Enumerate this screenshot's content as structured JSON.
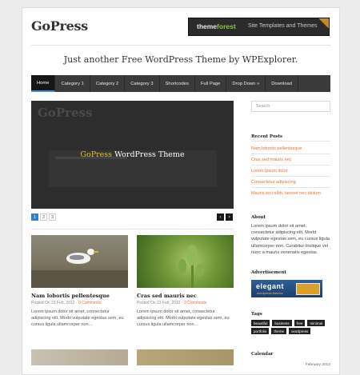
{
  "site": {
    "logo": "GoPress",
    "tagline": "Just another Free WordPress Theme by WPExplorer."
  },
  "banner": {
    "brand_prefix": "theme",
    "brand_suffix": "forest",
    "tagline": "Site Templates and Themes"
  },
  "nav": {
    "items": [
      {
        "label": "Home",
        "active": true
      },
      {
        "label": "Category 1",
        "active": false
      },
      {
        "label": "Category 2",
        "active": false
      },
      {
        "label": "Category 3",
        "active": false
      },
      {
        "label": "Shortcodes",
        "active": false
      },
      {
        "label": "Full Page",
        "active": false
      },
      {
        "label": "Drop Down »",
        "active": false
      },
      {
        "label": "Download",
        "active": false
      }
    ]
  },
  "slider": {
    "caption_brand": "GoPress",
    "caption_rest": " WordPress Theme",
    "pages": [
      "1",
      "2",
      "3"
    ],
    "current_page": 1,
    "prev_label": "‹",
    "next_label": "›"
  },
  "posts": [
    {
      "title": "Nam lobortis pellentesque",
      "date_prefix": "Posted On 23 Feb, 2012 · ",
      "comments": "0 Comments",
      "excerpt": "Lorem ipsum dolor sit amet, consectetur adipiscing elit. Morbi vulputate egestas sem, eu cursus ligula ullamcorper non…"
    },
    {
      "title": "Cras sed mauris nec",
      "date_prefix": "Posted On 23 Feb, 2012 · ",
      "comments": "0 Comments",
      "excerpt": "Lorem ipsum dolor sit amet, consectetur adipiscing elit. Morbi vulputate egestas sem, eu cursus ligula ullamcorper non…"
    }
  ],
  "sidebar": {
    "search_placeholder": "Search",
    "recent_title": "Recent Posts",
    "recent": [
      "Nam lobortis pellentesque",
      "Cras sed mauris nec",
      "Lorem ipsum dolor",
      "Consectetur adipiscing",
      "Mauris orci nibh, laoreet nec dictum"
    ],
    "about_title": "About",
    "about_text": "Lorem ipsum dolor sit amet, consectetur adipiscing elit. Morbi vulputate egestas sem, eu cursus ligula ullamcorper non. Curabitur tristique vel nunc a mauris venenatis egestas.",
    "ad_title": "Advertisement",
    "ad_brand": "elegant",
    "ad_sub": "wordpress themes",
    "tags_title": "Tags",
    "tags": [
      "beautiful",
      "business",
      "free",
      "minimal",
      "portfolio",
      "theme",
      "wordpress"
    ],
    "calendar_title": "Calendar",
    "calendar_month": "February 2012"
  },
  "colors": {
    "accent_orange": "#e8732c",
    "nav_bg": "#3a3a3a",
    "nav_active_underline": "#3b8dd8",
    "slider_brand_yellow": "#e8c12c"
  }
}
